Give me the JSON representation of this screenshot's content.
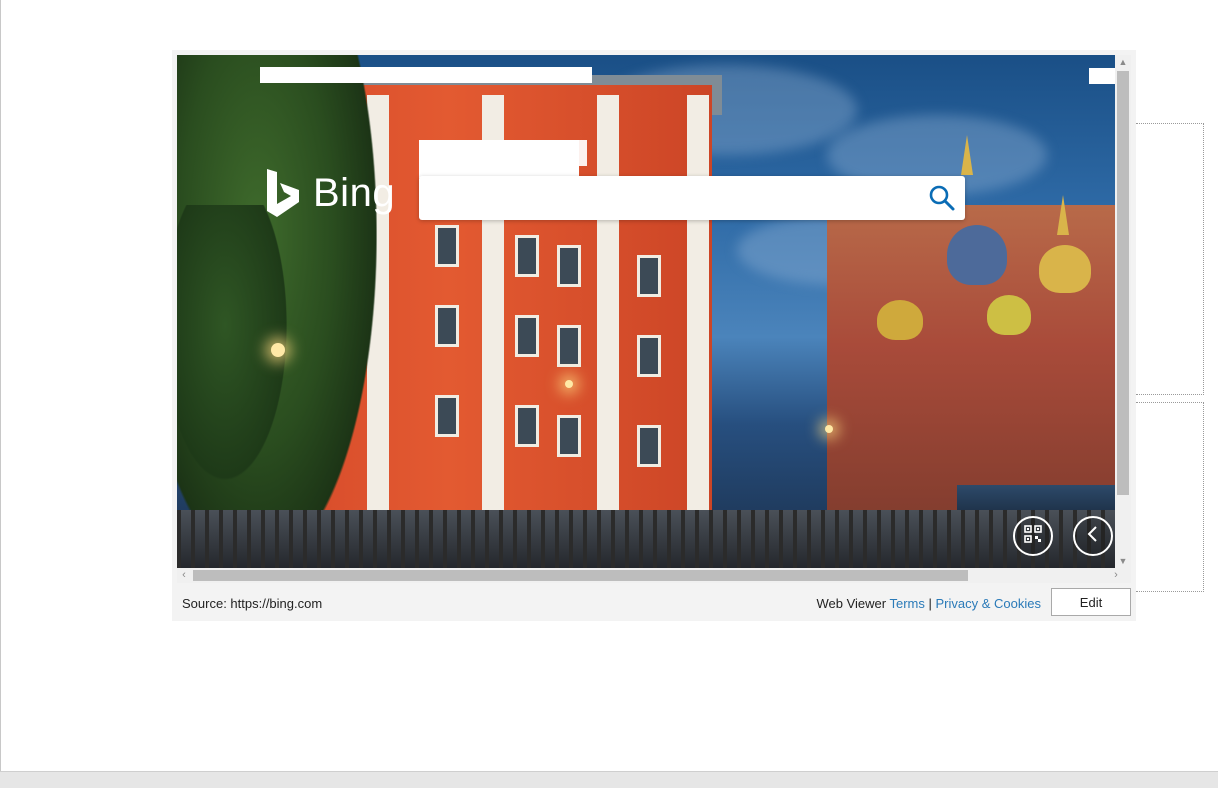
{
  "bing": {
    "logo_text": "Bing",
    "search_value": "",
    "search_placeholder": ""
  },
  "icons": {
    "search": "magnifier-icon",
    "qr": "qr-code-icon",
    "back": "chevron-left-icon"
  },
  "footer": {
    "source_label": "Source: https://bing.com",
    "web_viewer_label": "Web Viewer",
    "terms_link": "Terms",
    "separator": "|",
    "privacy_link": "Privacy & Cookies",
    "edit_button": "Edit"
  },
  "colors": {
    "link": "#2a7ab8",
    "frame_bg": "#f3f3f3"
  }
}
